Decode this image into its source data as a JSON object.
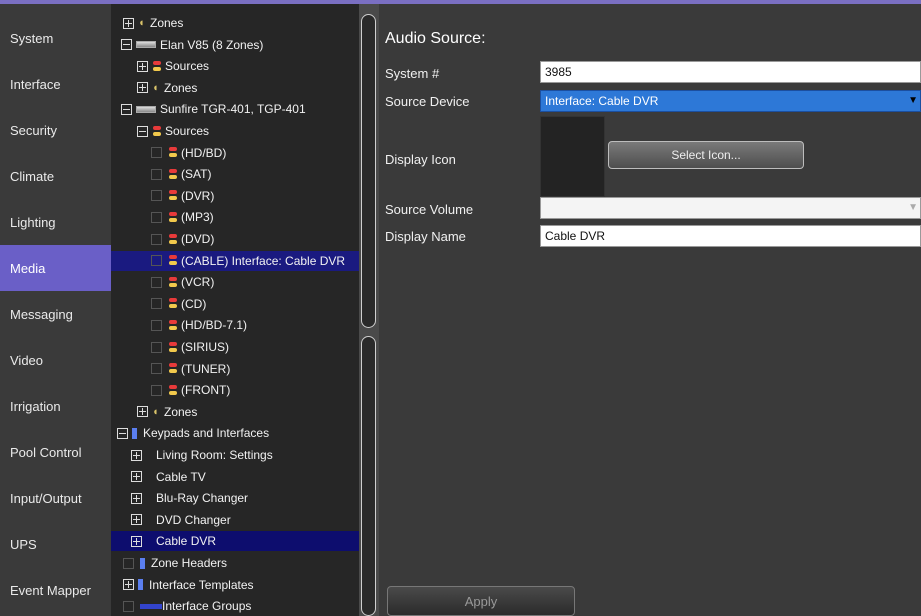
{
  "nav": [
    "System",
    "Interface",
    "Security",
    "Climate",
    "Lighting",
    "Media",
    "Messaging",
    "Video",
    "Irrigation",
    "Pool Control",
    "Input/Output",
    "UPS",
    "Event Mapper"
  ],
  "nav_active": "Media",
  "tree": [
    {
      "label": "Zones",
      "expander": "plus",
      "icon": "zone"
    },
    {
      "label": "Elan V85 (8 Zones)",
      "expander": "minus",
      "icon": "device"
    },
    {
      "label": "Sources",
      "expander": "plus",
      "icon": "source"
    },
    {
      "label": "Zones",
      "expander": "plus",
      "icon": "zone"
    },
    {
      "label": "Sunfire TGR-401, TGP-401",
      "expander": "minus",
      "icon": "device"
    },
    {
      "label": "Sources",
      "expander": "minus",
      "icon": "source"
    },
    {
      "label": "(HD/BD)",
      "check": true,
      "icon": "source"
    },
    {
      "label": "(SAT)",
      "check": true,
      "icon": "source"
    },
    {
      "label": "(DVR)",
      "check": true,
      "icon": "source"
    },
    {
      "label": "(MP3)",
      "check": true,
      "icon": "source"
    },
    {
      "label": "(DVD)",
      "check": true,
      "icon": "source"
    },
    {
      "label": "(CABLE) Interface: Cable DVR",
      "check": true,
      "icon": "source",
      "selected": true
    },
    {
      "label": "(VCR)",
      "check": true,
      "icon": "source"
    },
    {
      "label": "(CD)",
      "check": true,
      "icon": "source"
    },
    {
      "label": "(HD/BD-7.1)",
      "check": true,
      "icon": "source"
    },
    {
      "label": "(SIRIUS)",
      "check": true,
      "icon": "source"
    },
    {
      "label": "(TUNER)",
      "check": true,
      "icon": "source"
    },
    {
      "label": "(FRONT)",
      "check": true,
      "icon": "source"
    },
    {
      "label": "Zones",
      "expander": "plus",
      "icon": "zone"
    },
    {
      "label": "Keypads and Interfaces",
      "expander": "minus",
      "icon": "keypad"
    },
    {
      "label": "Living Room: Settings",
      "expander": "plus",
      "icon": "none"
    },
    {
      "label": "Cable TV",
      "expander": "plus",
      "icon": "none"
    },
    {
      "label": "Blu-Ray Changer",
      "expander": "plus",
      "icon": "none"
    },
    {
      "label": "DVD Changer",
      "expander": "plus",
      "icon": "none"
    },
    {
      "label": "Cable DVR",
      "expander": "plus",
      "icon": "none",
      "selected2": true
    },
    {
      "label": "Zone Headers",
      "check": true,
      "icon": "keypad"
    },
    {
      "label": "Interface Templates",
      "expander": "plus",
      "icon": "keypad"
    },
    {
      "label": "Interface Groups",
      "check": true,
      "icon": "group"
    }
  ],
  "panel": {
    "title": "Audio Source:",
    "system_label": "System #",
    "system_value": "3985",
    "source_device_label": "Source Device",
    "source_device_value": "Interface: Cable DVR",
    "display_icon_label": "Display Icon",
    "select_icon_button": "Select Icon...",
    "source_volume_label": "Source Volume",
    "source_volume_value": "",
    "display_name_label": "Display Name",
    "display_name_value": "Cable DVR",
    "apply_button": "Apply"
  }
}
